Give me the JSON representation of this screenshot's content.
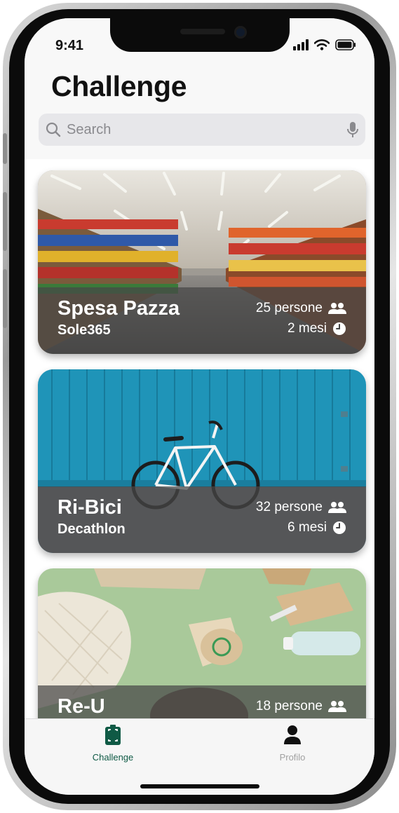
{
  "status_bar": {
    "time": "9:41"
  },
  "header": {
    "title": "Challenge"
  },
  "search": {
    "placeholder": "Search"
  },
  "challenges": [
    {
      "title": "Spesa Pazza",
      "sponsor": "Sole365",
      "participants": "25 persone",
      "duration": "2 mesi"
    },
    {
      "title": "Ri-Bici",
      "sponsor": "Decathlon",
      "participants": "32 persone",
      "duration": "6 mesi"
    },
    {
      "title": "Re-U",
      "sponsor": "",
      "participants": "18 persone",
      "duration": ""
    }
  ],
  "tabbar": {
    "items": [
      {
        "label": "Challenge",
        "icon": "challenge-scan-icon",
        "active": true
      },
      {
        "label": "Profilo",
        "icon": "person-icon",
        "active": false
      }
    ]
  },
  "colors": {
    "accent": "#0f5a45",
    "inactive": "#a1a1a1",
    "card_overlay": "#464646"
  }
}
